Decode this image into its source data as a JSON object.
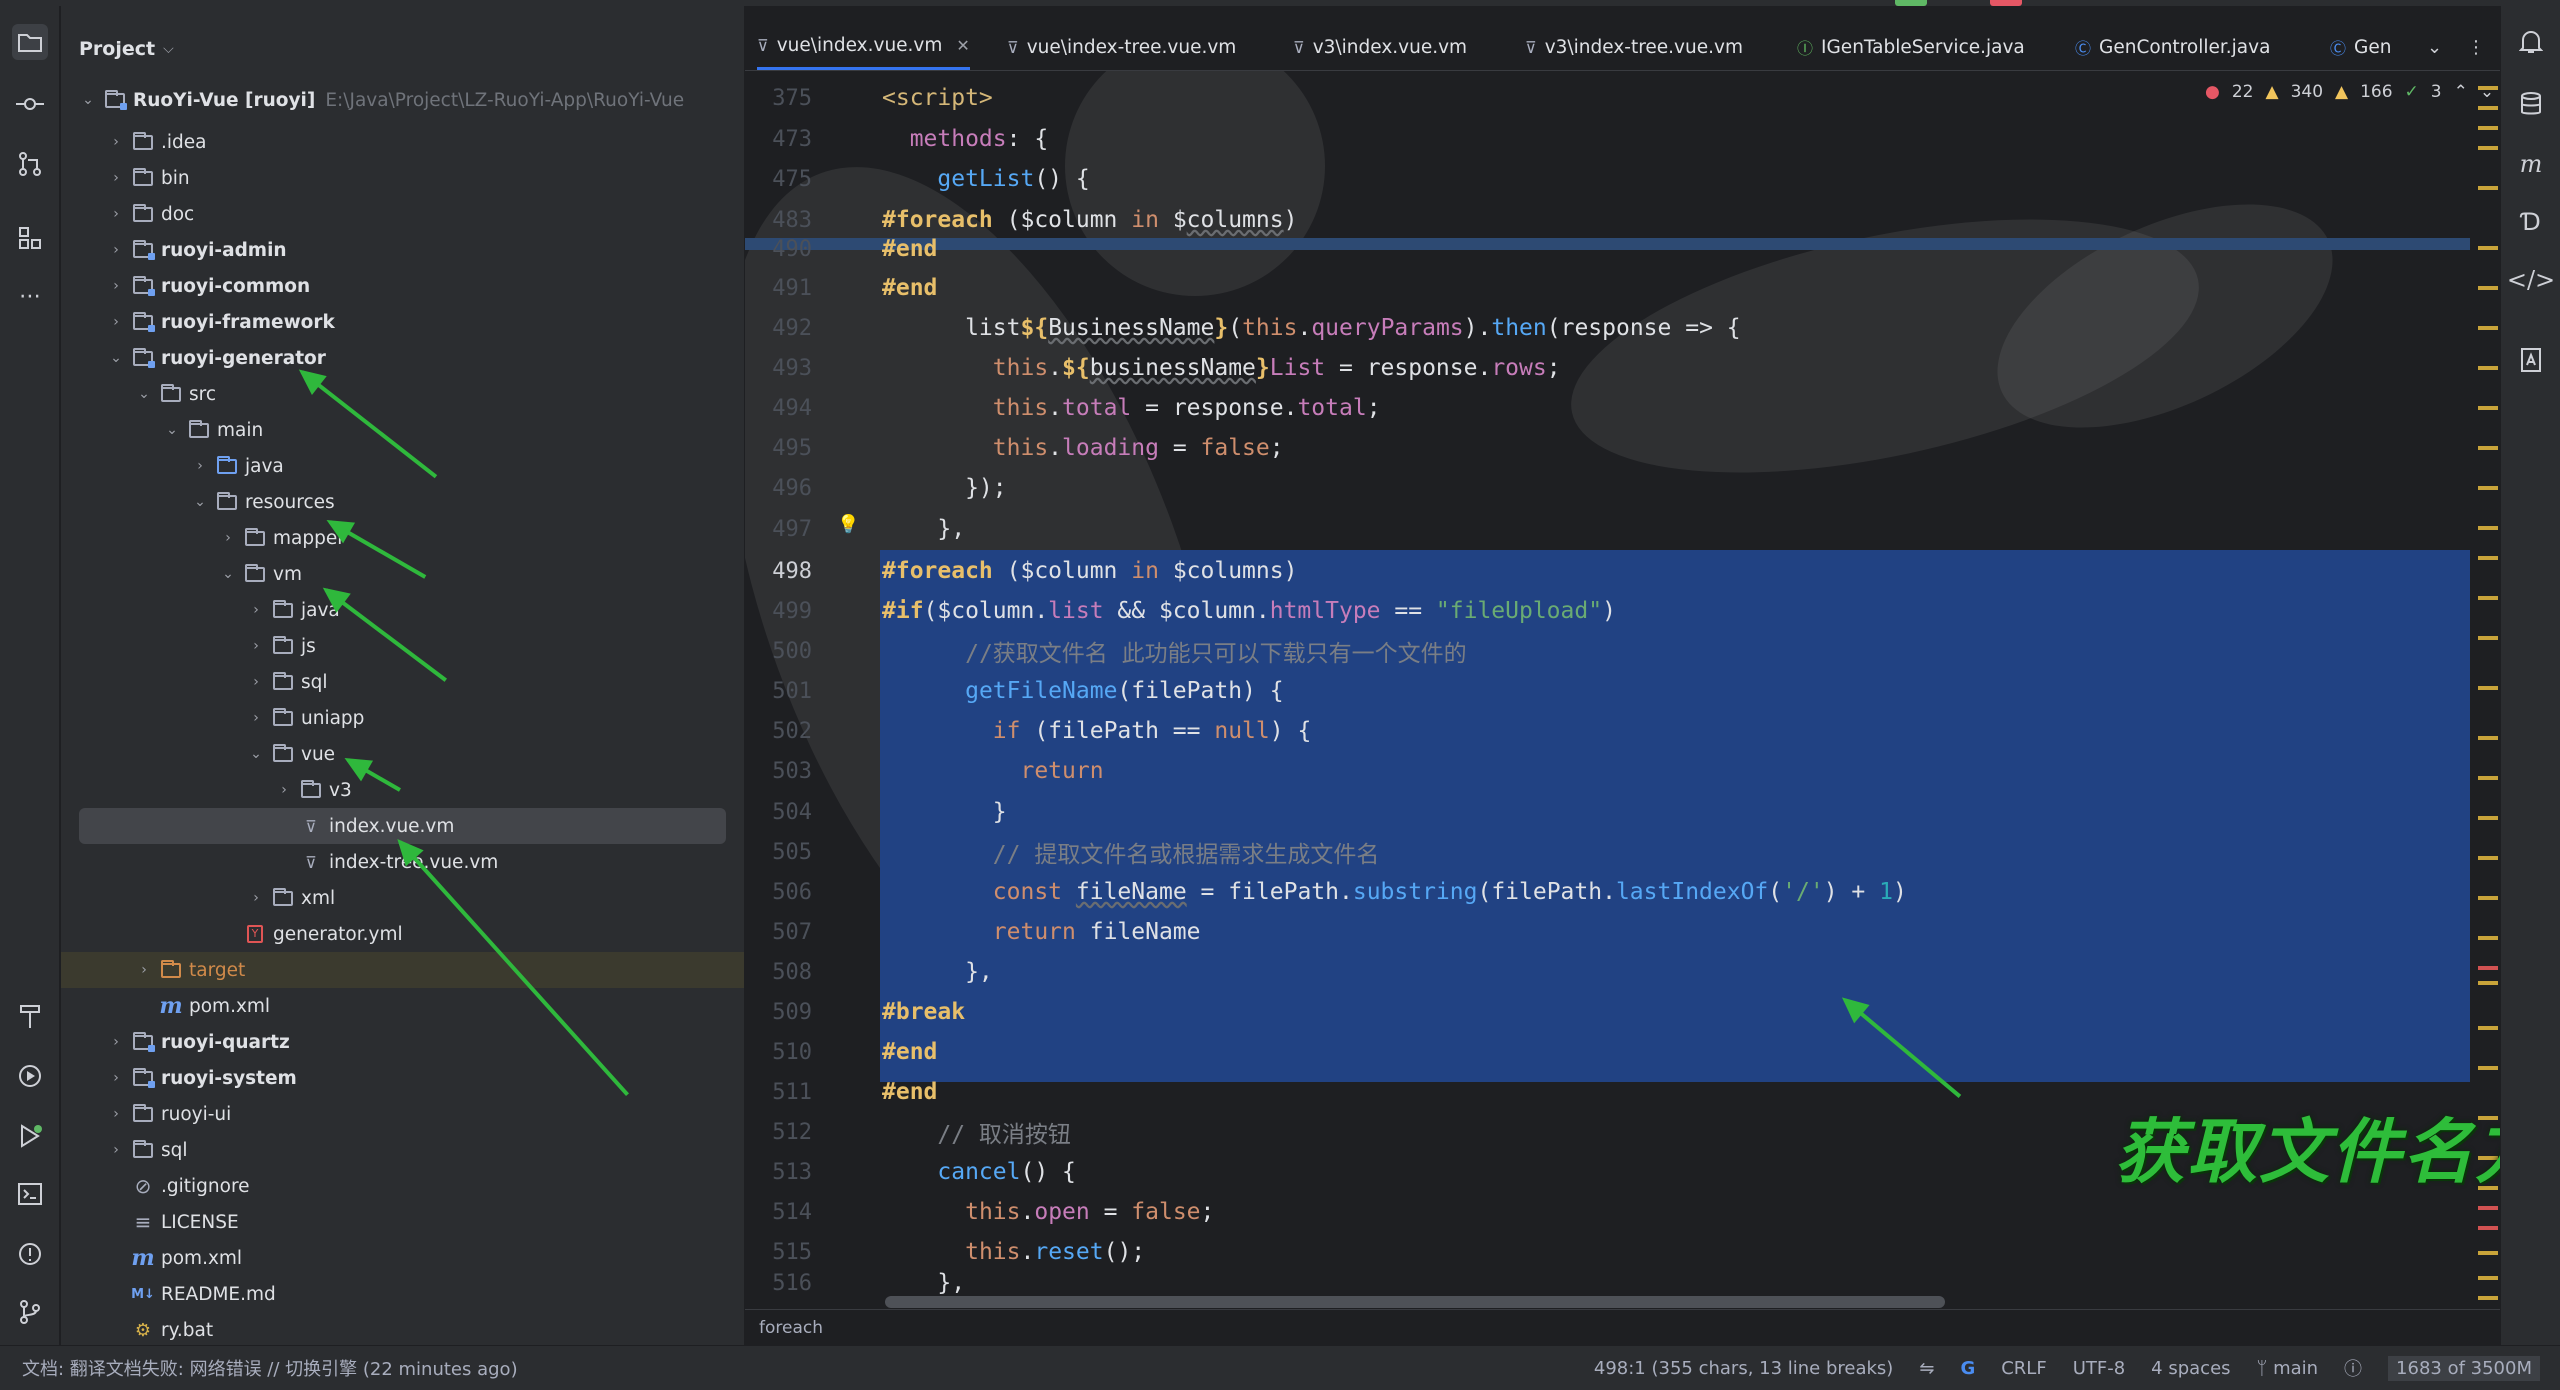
{
  "project": {
    "title": "Project",
    "root": {
      "name": "RuoYi-Vue [ruoyi]",
      "path": "E:\\Java\\Project\\LZ-RuoYi-App\\RuoYi-Vue"
    },
    "items": [
      ".idea",
      "bin",
      "doc",
      "ruoyi-admin",
      "ruoyi-common",
      "ruoyi-framework",
      "ruoyi-generator",
      "src",
      "main",
      "java",
      "resources",
      "mapper",
      "vm",
      "java",
      "js",
      "sql",
      "uniapp",
      "vue",
      "v3",
      "index.vue.vm",
      "index-tree.vue.vm",
      "xml",
      "generator.yml",
      "target",
      "pom.xml",
      "ruoyi-quartz",
      "ruoyi-system",
      "ruoyi-ui",
      "sql",
      ".gitignore",
      "LICENSE",
      "pom.xml",
      "README.md",
      "ry.bat"
    ]
  },
  "tabs": [
    {
      "label": "vue\\index.vue.vm",
      "active": true
    },
    {
      "label": "vue\\index-tree.vue.vm"
    },
    {
      "label": "v3\\index.vue.vm"
    },
    {
      "label": "v3\\index-tree.vue.vm"
    },
    {
      "label": "IGenTableService.java"
    },
    {
      "label": "GenController.java"
    },
    {
      "label": "Gen"
    }
  ],
  "inspections": {
    "errors": "22",
    "warnings": "340",
    "weak": "166",
    "ok": "3"
  },
  "gutter": [
    "375",
    "473",
    "475",
    "483",
    "490",
    "491",
    "492",
    "493",
    "494",
    "495",
    "496",
    "497",
    "498",
    "499",
    "500",
    "501",
    "502",
    "503",
    "504",
    "505",
    "506",
    "507",
    "508",
    "509",
    "510",
    "511",
    "512",
    "513",
    "514",
    "515",
    "516"
  ],
  "overlay_text": "获取文件名方法",
  "breadcrumb": "foreach",
  "statusbar": {
    "left": "文档: 翻译文档失败: 网络错误 // 切换引擎 (22 minutes ago)",
    "position": "498:1 (355 chars, 13 line breaks)",
    "line_sep": "CRLF",
    "encoding": "UTF-8",
    "indent": "4 spaces",
    "branch": "main",
    "memory": "1683 of 3500M"
  },
  "colors": {
    "accent": "#3574f0",
    "selection": "#214283",
    "annotation": "#2fb83c"
  }
}
